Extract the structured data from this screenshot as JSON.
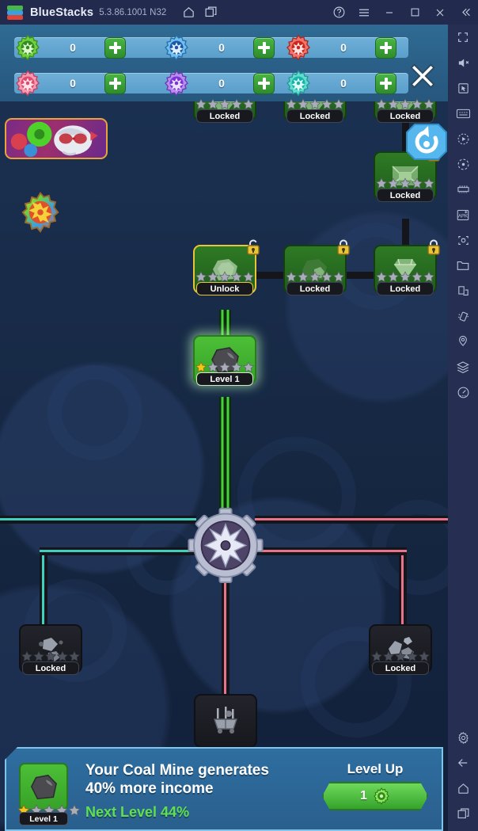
{
  "titlebar": {
    "app_name": "BlueStacks",
    "version": "5.3.86.1001 N32",
    "icons": [
      "bluestacks-logo-icon",
      "home-icon",
      "multi-instance-icon",
      "help-icon",
      "menu-icon",
      "minimize-icon",
      "maximize-icon",
      "close-icon",
      "collapse-icon"
    ]
  },
  "sidebar": {
    "items": [
      {
        "name": "fullscreen-icon"
      },
      {
        "name": "mute-icon"
      },
      {
        "name": "cursor-icon"
      },
      {
        "name": "keyboard-controls-icon"
      },
      {
        "name": "macro-recorder-icon"
      },
      {
        "name": "rotate-icon"
      },
      {
        "name": "gamepad-icon"
      },
      {
        "name": "install-apk-icon"
      },
      {
        "name": "screenshot-icon"
      },
      {
        "name": "media-manager-icon"
      },
      {
        "name": "multi-instance-manager-icon"
      },
      {
        "name": "shake-icon"
      },
      {
        "name": "location-icon"
      },
      {
        "name": "layers-icon"
      },
      {
        "name": "performance-icon"
      }
    ],
    "bottom_items": [
      {
        "name": "settings-icon"
      },
      {
        "name": "back-icon"
      },
      {
        "name": "home-icon"
      },
      {
        "name": "recents-icon"
      }
    ]
  },
  "resources": {
    "rows": [
      [
        {
          "gear": "green-gear-icon",
          "color": "#6fd13c",
          "value": "0",
          "add": "+"
        },
        {
          "gear": "blue-gear-icon",
          "color": "#3f9be0",
          "value": "0",
          "add": "+"
        },
        {
          "gear": "red-gear-icon",
          "color": "#e2453c",
          "value": "0",
          "add": "+"
        }
      ],
      [
        {
          "gear": "pink-gear-icon",
          "color": "#ef6b8a",
          "value": "0",
          "add": "+"
        },
        {
          "gear": "purple-gear-icon",
          "color": "#9b5ae0",
          "value": "0",
          "add": "+"
        },
        {
          "gear": "teal-gear-icon",
          "color": "#3fd0c0",
          "value": "0",
          "add": "+"
        }
      ]
    ],
    "close_label": "X"
  },
  "tree": {
    "refresh_label": "refresh-icon",
    "nodes": [
      {
        "id": "top-1",
        "status": "Locked",
        "icon": "mineral-icon",
        "stars_filled": 0,
        "stars_total": 5,
        "locked": true,
        "style": "green"
      },
      {
        "id": "top-2",
        "status": "Locked",
        "icon": "mineral-icon",
        "stars_filled": 0,
        "stars_total": 5,
        "locked": true,
        "style": "green"
      },
      {
        "id": "top-3",
        "status": "Locked",
        "icon": "mineral-icon",
        "stars_filled": 0,
        "stars_total": 5,
        "locked": true,
        "style": "green"
      },
      {
        "id": "emerald",
        "status": "Locked",
        "icon": "emerald-icon",
        "stars_filled": 0,
        "stars_total": 5,
        "locked": true,
        "style": "green"
      },
      {
        "id": "stone",
        "status": "Unlock",
        "icon": "stone-icon",
        "stars_filled": 0,
        "stars_total": 5,
        "locked": true,
        "style": "unlock"
      },
      {
        "id": "ore",
        "status": "Locked",
        "icon": "ore-icon",
        "stars_filled": 0,
        "stars_total": 5,
        "locked": true,
        "style": "green"
      },
      {
        "id": "diamond",
        "status": "Locked",
        "icon": "diamond-icon",
        "stars_filled": 0,
        "stars_total": 5,
        "locked": true,
        "style": "green"
      },
      {
        "id": "coal",
        "status": "Level 1",
        "icon": "coal-icon",
        "stars_filled": 1,
        "stars_total": 5,
        "locked": false,
        "style": "active"
      },
      {
        "id": "silver",
        "status": "Locked",
        "icon": "silver-ore-icon",
        "stars_filled": 0,
        "stars_total": 5,
        "locked": false,
        "style": "dark"
      },
      {
        "id": "rocks",
        "status": "Locked",
        "icon": "rocks-icon",
        "stars_filled": 0,
        "stars_total": 5,
        "locked": false,
        "style": "dark"
      },
      {
        "id": "minecart",
        "status": "",
        "icon": "minecart-icon",
        "stars_filled": 0,
        "stars_total": 5,
        "locked": false,
        "style": "dark"
      }
    ],
    "hub_label": "central-gear-hub"
  },
  "promo": {
    "label": "promo-banner"
  },
  "banner": {
    "icon": "coal-icon",
    "level_plate": "Level 1",
    "headline_line1": "Your Coal Mine generates",
    "headline_line2": "40% more income",
    "next_level": "Next Level 44%",
    "level_up_label": "Level Up",
    "level_up_cost": "1",
    "level_up_currency": "green-gear-icon"
  },
  "colors": {
    "accent_green": "#5fe04e",
    "banner_blue": "#2e6ea0",
    "gold": "#e8c43a"
  }
}
